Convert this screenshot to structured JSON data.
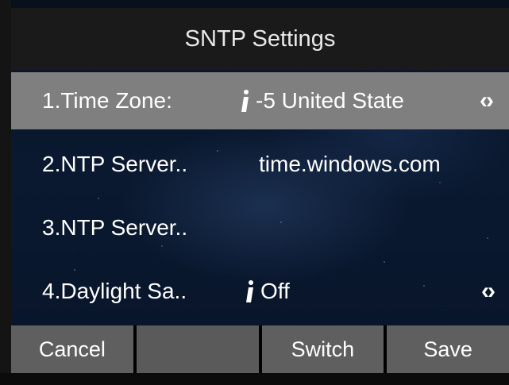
{
  "screen": {
    "title": "SNTP Settings"
  },
  "rows": [
    {
      "label": "1.Time Zone:",
      "value": "-5 United State"
    },
    {
      "label": "2.NTP Server..",
      "value": "time.windows.com"
    },
    {
      "label": "3.NTP Server..",
      "value": ""
    },
    {
      "label": "4.Daylight Sa..",
      "value": "Off"
    }
  ],
  "softkeys": [
    {
      "label": "Cancel"
    },
    {
      "label": ""
    },
    {
      "label": "Switch"
    },
    {
      "label": "Save"
    }
  ],
  "colors": {
    "selected_row": "#7f7f7f",
    "softkey": "#5f5f5f",
    "titlebar": "#1a1a1a"
  },
  "icons": [
    "info-icon",
    "left-right-arrows-icon"
  ]
}
